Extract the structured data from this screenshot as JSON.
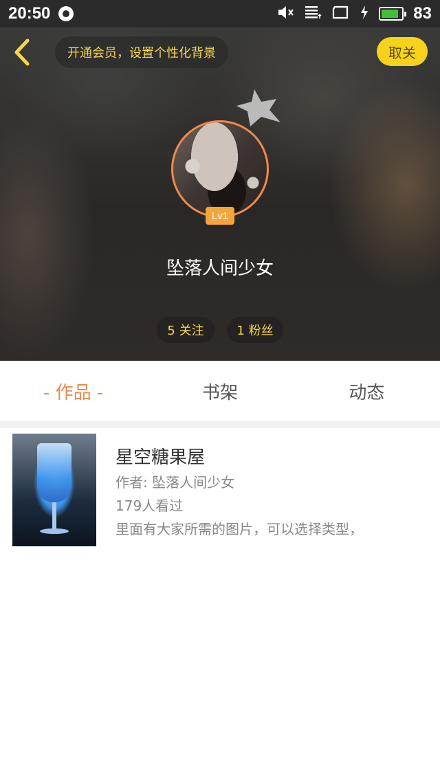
{
  "status_bar": {
    "time": "20:50",
    "battery_percent": "83",
    "battery_level": 0.83,
    "icons": [
      "sync-icon",
      "mute-icon",
      "data-icon",
      "screen-icon",
      "charging-icon",
      "battery-icon"
    ]
  },
  "header": {
    "vip_banner": "开通会员，设置个性化背景",
    "follow_button": "取关",
    "level": "Lv1",
    "username": "坠落人间少女",
    "following": "5 关注",
    "fans": "1 粉丝"
  },
  "tabs": [
    {
      "label": "- 作品 -",
      "active": true
    },
    {
      "label": "书架",
      "active": false
    },
    {
      "label": "动态",
      "active": false
    }
  ],
  "works": [
    {
      "title": "星空糖果屋",
      "author": "作者: 坠落人间少女",
      "views": "179人看过",
      "description": "里面有大家所需的图片，可以选择类型，"
    }
  ],
  "colors": {
    "accent_orange": "#ef8a4a",
    "accent_yellow": "#f7d21d",
    "badge": "#f2a53a"
  }
}
